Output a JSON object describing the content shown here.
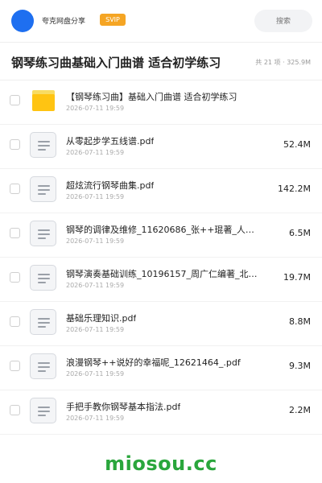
{
  "header": {
    "share_name": "夸克网盘分享",
    "badge": "SVIP",
    "search_placeholder": "搜索",
    "accent_color": "#1e6ff0",
    "badge_color": "#f5a524"
  },
  "folder": {
    "title": "钢琴练习曲基础入门曲谱 适合初学练习",
    "meta": "共 21 项 · 325.9M"
  },
  "files": [
    {
      "type": "folder",
      "name": "【钢琴练习曲】基础入门曲谱 适合初学练习",
      "date": "2026-07-11 19:59",
      "size": ""
    },
    {
      "type": "file",
      "name": "从零起步学五线谱.pdf",
      "date": "2026-07-11 19:59",
      "size": "52.4M"
    },
    {
      "type": "file",
      "name": "超炫流行钢琴曲集.pdf",
      "date": "2026-07-11 19:59",
      "size": "142.2M"
    },
    {
      "type": "file",
      "name": "钢琴的调律及维修_11620686_张++琨著_人…",
      "date": "2026-07-11 19:59",
      "size": "6.5M"
    },
    {
      "type": "file",
      "name": "钢琴演奏基础训练_10196157_周广仁编著_北…",
      "date": "2026-07-11 19:59",
      "size": "19.7M"
    },
    {
      "type": "file",
      "name": "基础乐理知识.pdf",
      "date": "2026-07-11 19:59",
      "size": "8.8M"
    },
    {
      "type": "file",
      "name": "浪漫钢琴++说好的幸福呢_12621464_.pdf",
      "date": "2026-07-11 19:59",
      "size": "9.3M"
    },
    {
      "type": "file",
      "name": "手把手教你钢琴基本指法.pdf",
      "date": "2026-07-11 19:59",
      "size": "2.2M"
    }
  ],
  "watermark": "miosou.cc"
}
